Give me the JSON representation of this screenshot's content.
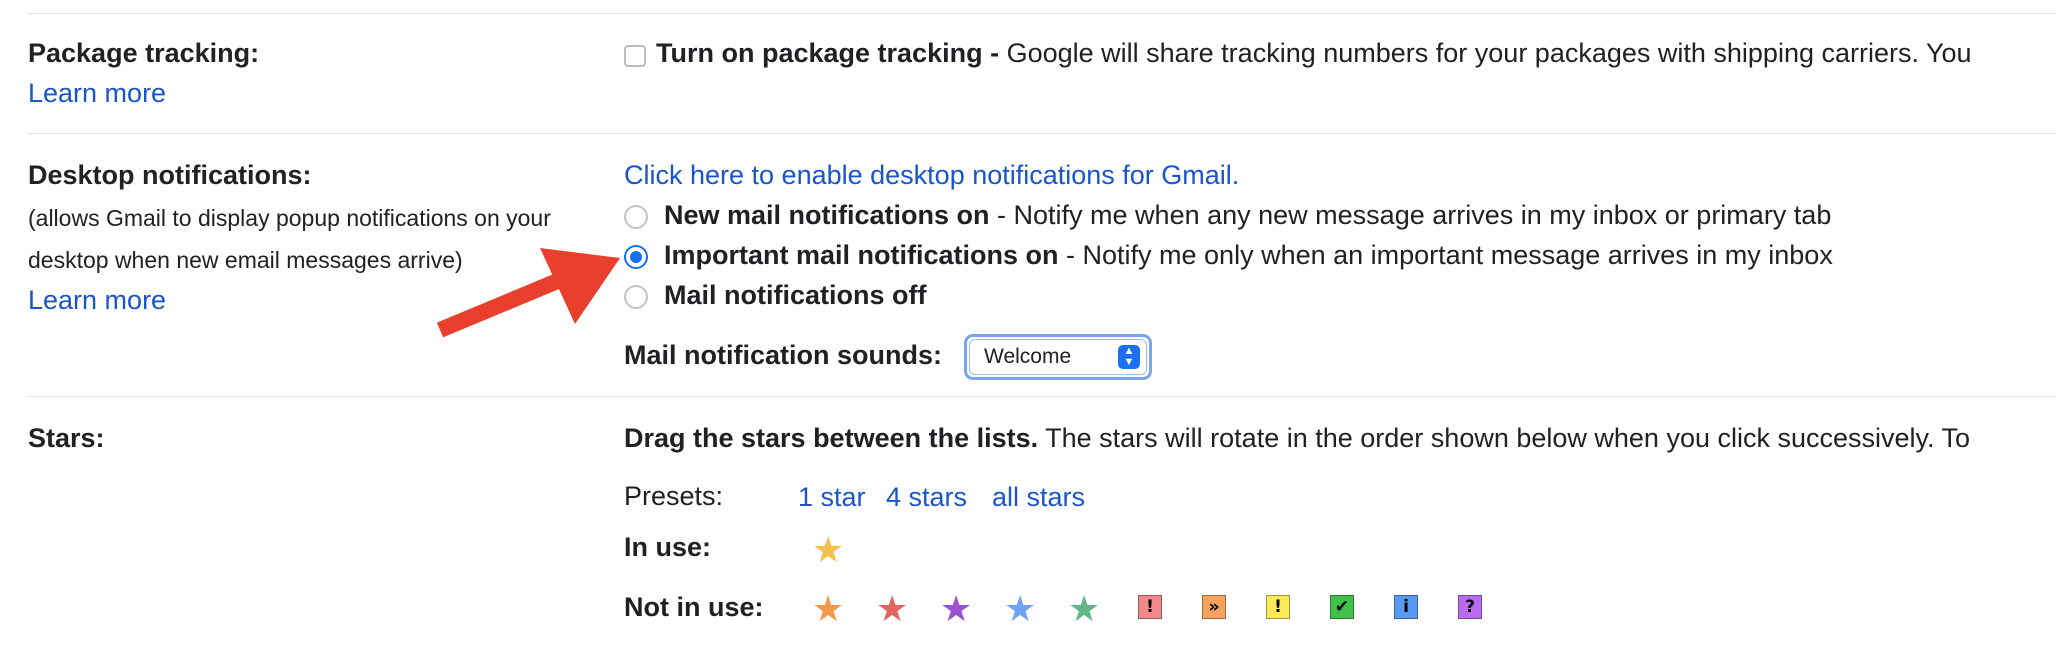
{
  "package_tracking": {
    "label": "Package tracking:",
    "learn_more": "Learn more",
    "option_bold": "Turn on package tracking -",
    "option_desc": " Google will share tracking numbers for your packages with shipping carriers. You"
  },
  "desktop_notifications": {
    "label": "Desktop notifications:",
    "desc_line1": "(allows Gmail to display popup notifications on your",
    "desc_line2": "desktop when new email messages arrive)",
    "learn_more": "Learn more",
    "enable_link": "Click here to enable desktop notifications for Gmail.",
    "options": [
      {
        "bold": "New mail notifications on",
        "desc": " - Notify me when any new message arrives in my inbox or primary tab",
        "selected": false
      },
      {
        "bold": "Important mail notifications on",
        "desc": " - Notify me only when an important message arrives in my inbox",
        "selected": true
      },
      {
        "bold": "Mail notifications off",
        "desc": "",
        "selected": false
      }
    ],
    "sounds_label": "Mail notification sounds:",
    "sounds_value": "Welcome"
  },
  "stars": {
    "label": "Stars:",
    "instruction_bold": "Drag the stars between the lists.",
    "instruction_rest": "  The stars will rotate in the order shown below when you click successively. To",
    "presets_label": "Presets:",
    "presets": [
      "1 star",
      "4 stars",
      "all stars"
    ],
    "in_use_label": "In use:",
    "not_in_use_label": "Not in use:",
    "in_use_icons": [
      "yellow-star"
    ],
    "not_in_use_icons": [
      "orange-star",
      "red-star",
      "purple-star",
      "blue-star",
      "green-star",
      "red-bang",
      "orange-guillemet",
      "yellow-bang",
      "green-check",
      "blue-info",
      "purple-question"
    ],
    "glyphs": {
      "star": "★",
      "bang": "!",
      "guillemet": "»",
      "check": "✔",
      "info": "i",
      "question": "?"
    },
    "colors": {
      "yellow": "#f6c04d",
      "orange": "#f2994a",
      "red": "#e0675f",
      "purple": "#9b51cf",
      "blue": "#6fa3f5",
      "green": "#5fb886",
      "red_box": "#f08a8a",
      "orange_box": "#f5a25f",
      "yellow_box": "#fbe95a",
      "green_box": "#43c04a",
      "blue_box": "#5a99f0",
      "purple_box": "#b96cf0"
    }
  },
  "annotation": {
    "arrow_color": "#e8402c"
  }
}
